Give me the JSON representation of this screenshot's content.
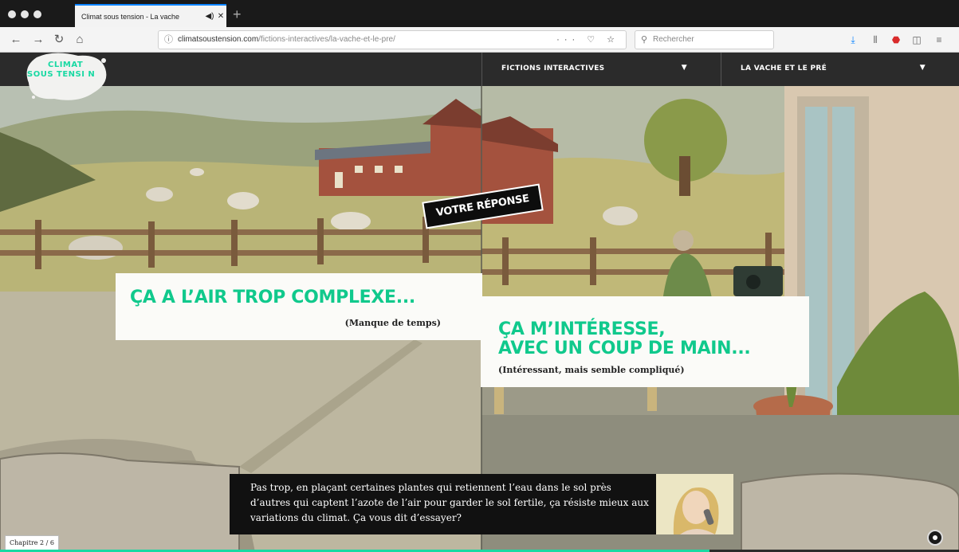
{
  "browser": {
    "tab_title": "Climat sous tension - La vache",
    "tab_audio_icon": "speaker-icon",
    "tab_close": "✕",
    "new_tab": "+",
    "url_domain": "climatsoustension.com",
    "url_path": "/fictions-interactives/la-vache-et-le-pre/",
    "url_actions": "··· ♡ ☆",
    "search_placeholder": "Rechercher",
    "nav": {
      "back": "←",
      "forward": "→",
      "reload": "↻",
      "home": "⌂"
    },
    "toolbar_icons": [
      "download-icon",
      "library-icon",
      "adblock-icon",
      "sidebar-icon",
      "menu-icon"
    ]
  },
  "site": {
    "logo_line1": "CLIMAT",
    "logo_line2": "SOUS TENSI N",
    "nav": [
      {
        "label": "FICTIONS INTERACTIVES",
        "caret": "▼"
      },
      {
        "label": "LA VACHE ET LE PRÉ",
        "caret": "▼"
      }
    ],
    "accent_color": "#19d9a3"
  },
  "choices": {
    "badge": "VOTRE RÉPONSE",
    "left": {
      "title": "ÇA A L’AIR TROP COMPLEXE...",
      "subtitle": "(Manque de temps)"
    },
    "right": {
      "title_line1": "ÇA M’INTÉRESSE,",
      "title_line2": "AVEC UN COUP DE MAIN...",
      "subtitle": "(Intéressant, mais semble compliqué)"
    }
  },
  "dialog": {
    "text": "Pas trop, en plaçant certaines plantes qui retiennent l’eau dans le sol près d’autres qui captent l’azote de l’air pour garder le sol fertile, ça résiste mieux aux variations du climat. Ça vous dit d’essayer?"
  },
  "chapter": "Chapitre 2 / 6",
  "progress_fraction": 0.74
}
